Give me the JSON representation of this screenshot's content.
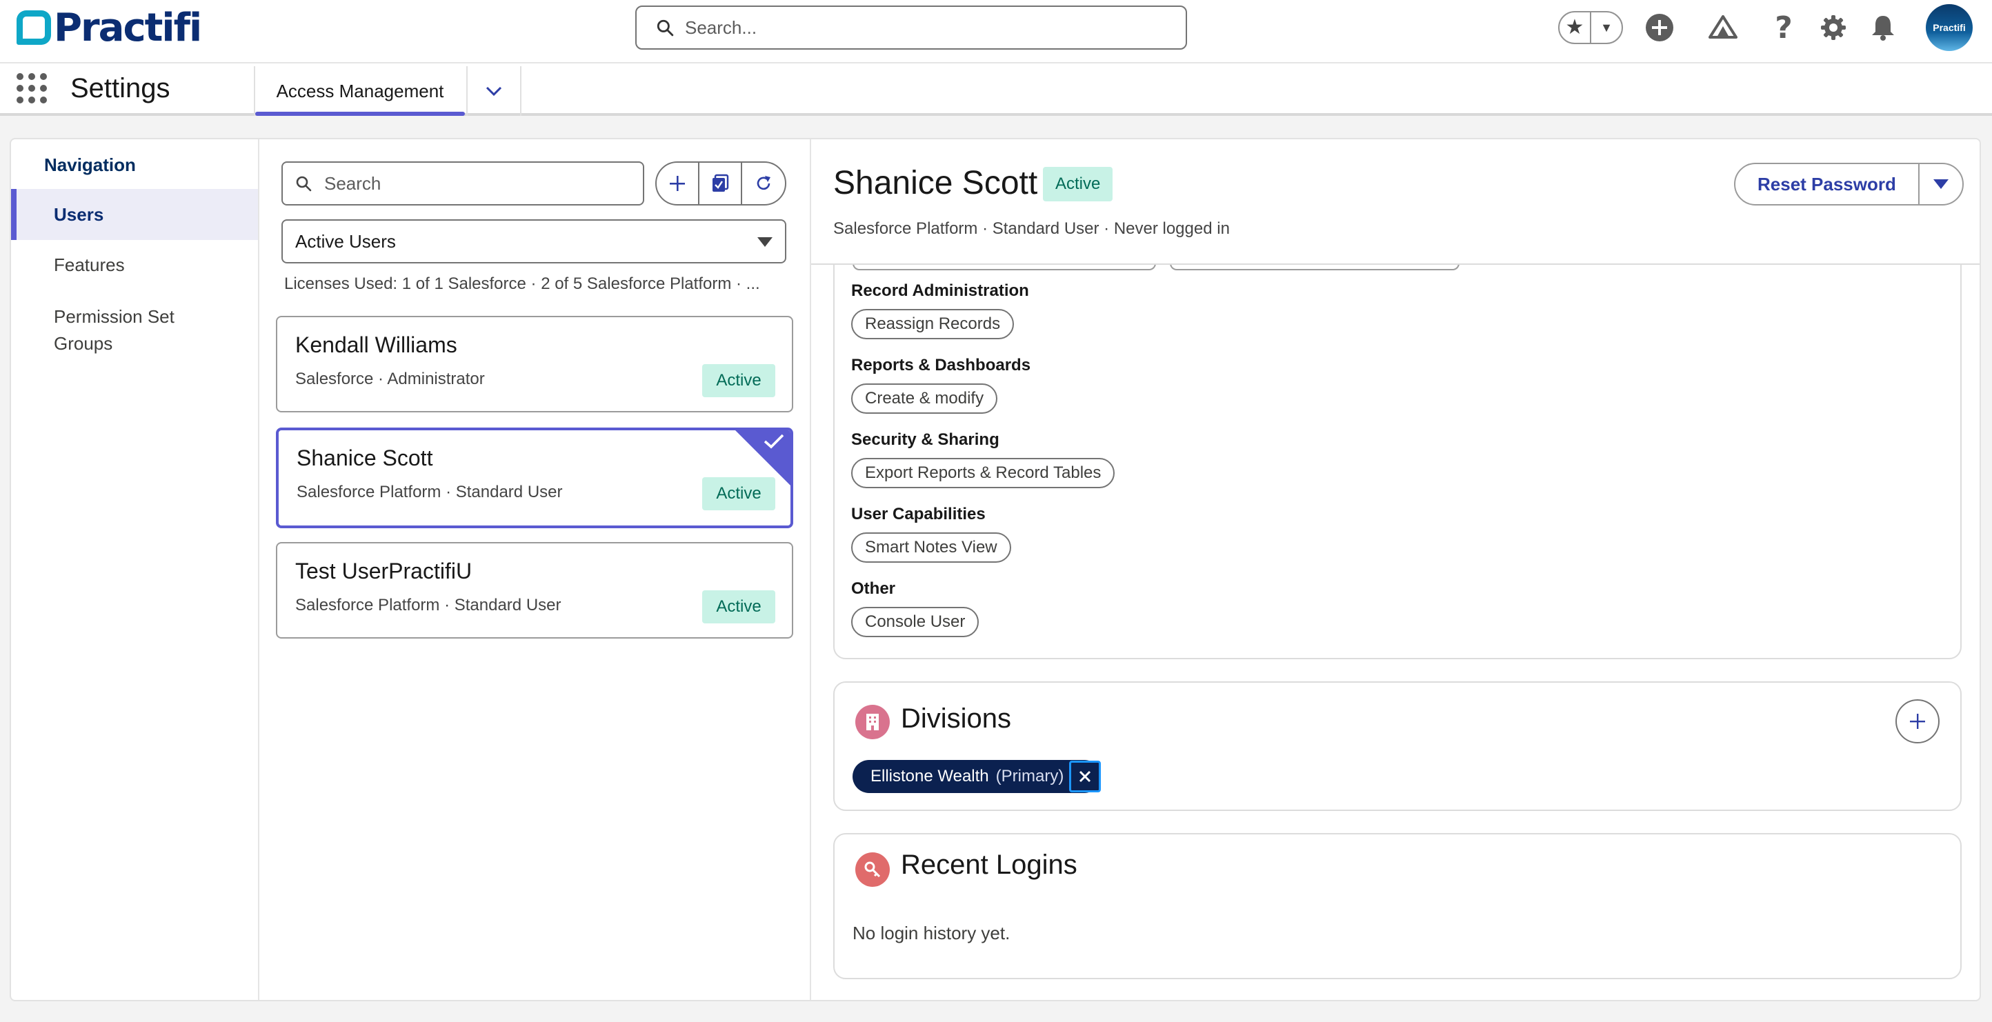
{
  "header": {
    "logo_text": "Practifi",
    "search_placeholder": "Search...",
    "avatar_text": "Practifi"
  },
  "appbar": {
    "app_name": "Settings",
    "active_tab": "Access Management"
  },
  "navigation": {
    "title": "Navigation",
    "items": [
      {
        "label": "Users",
        "selected": true
      },
      {
        "label": "Features",
        "selected": false
      },
      {
        "label": "Permission Set Groups",
        "selected": false
      }
    ]
  },
  "user_list": {
    "search_placeholder": "Search",
    "filter_value": "Active Users",
    "licenses_text": "Licenses Used: 1 of 1 Salesforce · 2 of 5 Salesforce Platform · ...",
    "users": [
      {
        "name": "Kendall Williams",
        "subtitle": "Salesforce · Administrator",
        "status": "Active",
        "selected": false
      },
      {
        "name": "Shanice Scott",
        "subtitle": "Salesforce Platform · Standard User",
        "status": "Active",
        "selected": true
      },
      {
        "name": "Test UserPractifiU",
        "subtitle": "Salesforce Platform · Standard User",
        "status": "Active",
        "selected": false
      }
    ]
  },
  "detail": {
    "name": "Shanice Scott",
    "status": "Active",
    "subtitle": "Salesforce Platform · Standard User · Never logged in",
    "reset_password_label": "Reset Password",
    "permission_groups": [
      {
        "label": "Record Administration",
        "pills": [
          "Reassign Records"
        ]
      },
      {
        "label": "Reports & Dashboards",
        "pills": [
          "Create & modify"
        ]
      },
      {
        "label": "Security & Sharing",
        "pills": [
          "Export Reports & Record Tables"
        ]
      },
      {
        "label": "User Capabilities",
        "pills": [
          "Smart Notes View"
        ]
      },
      {
        "label": "Other",
        "pills": [
          "Console User"
        ]
      }
    ],
    "divisions": {
      "title": "Divisions",
      "items": [
        {
          "name": "Ellistone Wealth",
          "tag": "(Primary)"
        }
      ]
    },
    "recent_logins": {
      "title": "Recent Logins",
      "empty_text": "No login history yet."
    }
  },
  "colors": {
    "accent": "#5a5ad1",
    "brand_navy": "#0b2d72",
    "active_badge_bg": "#c8f2e6",
    "active_badge_text": "#026b57",
    "division_icon": "#d9738e",
    "logins_icon": "#e06b6b"
  }
}
